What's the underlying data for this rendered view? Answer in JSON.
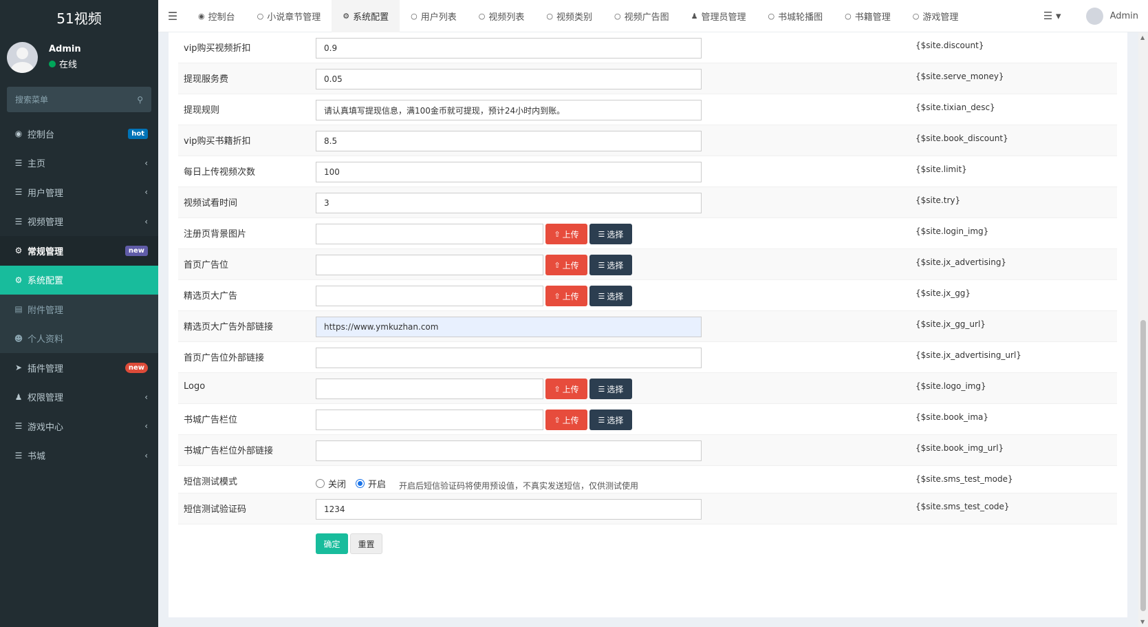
{
  "app": {
    "logo": "51视频"
  },
  "user": {
    "name": "Admin",
    "status": "在线"
  },
  "sidebar": {
    "search_placeholder": "搜索菜单",
    "items": [
      {
        "label": "控制台",
        "icon": "dashboard-icon",
        "badge": "hot",
        "badge_color": "#0073b7"
      },
      {
        "label": "主页",
        "icon": "list-icon"
      },
      {
        "label": "用户管理",
        "icon": "list-icon"
      },
      {
        "label": "视频管理",
        "icon": "list-icon"
      },
      {
        "label": "常规管理",
        "icon": "cogs-icon",
        "badge": "new",
        "badge_color": "#605ca8"
      },
      {
        "label": "系统配置",
        "icon": "cog-icon"
      },
      {
        "label": "附件管理",
        "icon": "file-icon"
      },
      {
        "label": "个人资料",
        "icon": "user-icon"
      },
      {
        "label": "插件管理",
        "icon": "rocket-icon",
        "badge": "new",
        "badge_color": "#dd4b39"
      },
      {
        "label": "权限管理",
        "icon": "group-icon"
      },
      {
        "label": "游戏中心",
        "icon": "list-icon"
      },
      {
        "label": "书城",
        "icon": "list-icon"
      }
    ]
  },
  "topnav": {
    "tabs": [
      {
        "label": "控制台"
      },
      {
        "label": "小说章节管理"
      },
      {
        "label": "系统配置"
      },
      {
        "label": "用户列表"
      },
      {
        "label": "视频列表"
      },
      {
        "label": "视频类别"
      },
      {
        "label": "视频广告图"
      },
      {
        "label": "管理员管理"
      },
      {
        "label": "书城轮播图"
      },
      {
        "label": "书籍管理"
      },
      {
        "label": "游戏管理"
      }
    ],
    "user": "Admin"
  },
  "form": {
    "upload_label": "上传",
    "select_label": "选择",
    "rows": [
      {
        "label": "vip购买视频折扣",
        "value": "0.9",
        "var": "{$site.discount}"
      },
      {
        "label": "提现服务费",
        "value": "0.05",
        "var": "{$site.serve_money}"
      },
      {
        "label": "提现规则",
        "value": "请认真填写提现信息，满100金币就可提现，预计24小时内到账。",
        "var": "{$site.tixian_desc}"
      },
      {
        "label": "vip购买书籍折扣",
        "value": "8.5",
        "var": "{$site.book_discount}"
      },
      {
        "label": "每日上传视频次数",
        "value": "100",
        "var": "{$site.limit}"
      },
      {
        "label": "视频试看时间",
        "value": "3",
        "var": "{$site.try}"
      },
      {
        "label": "注册页背景图片",
        "value": "",
        "var": "{$site.login_img}"
      },
      {
        "label": "首页广告位",
        "value": "",
        "var": "{$site.jx_advertising}"
      },
      {
        "label": "精选页大广告",
        "value": "",
        "var": "{$site.jx_gg}"
      },
      {
        "label": "精选页大广告外部链接",
        "value": "https://www.ymkuzhan.com",
        "var": "{$site.jx_gg_url}"
      },
      {
        "label": "首页广告位外部链接",
        "value": "",
        "var": "{$site.jx_advertising_url}"
      },
      {
        "label": "Logo",
        "value": "",
        "var": "{$site.logo_img}"
      },
      {
        "label": "书城广告栏位",
        "value": "",
        "var": "{$site.book_ima}"
      },
      {
        "label": "书城广告栏位外部链接",
        "value": "",
        "var": "{$site.book_img_url}"
      },
      {
        "label": "短信测试模式",
        "var": "{$site.sms_test_mode}",
        "options": [
          "关闭",
          "开启"
        ],
        "selected": "开启",
        "hint": "开启后短信验证码将使用预设值，不真实发送短信，仅供测试使用"
      },
      {
        "label": "短信测试验证码",
        "value": "1234",
        "var": "{$site.sms_test_code}"
      }
    ],
    "submit_label": "确定",
    "reset_label": "重置"
  }
}
